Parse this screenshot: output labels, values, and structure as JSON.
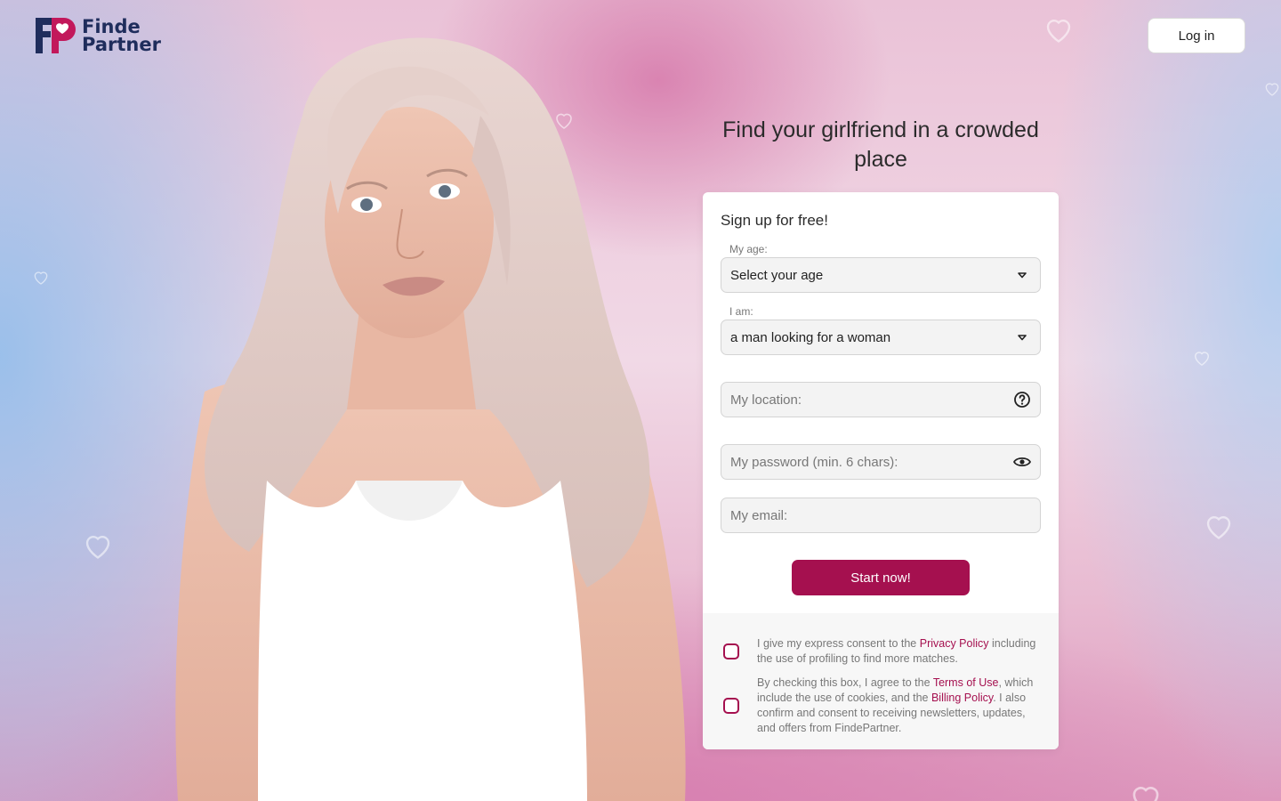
{
  "brand": {
    "logo_mark": "FP",
    "line1": "Finde",
    "line2": "Partner"
  },
  "header": {
    "login_label": "Log in"
  },
  "headline": "Find your girlfriend in a crowded place",
  "form": {
    "title": "Sign up for free!",
    "age": {
      "label": "My age:",
      "value": "Select your age",
      "icon": "chevron-down-icon"
    },
    "gender": {
      "label": "I am:",
      "value": "a man looking for a woman",
      "icon": "chevron-down-icon"
    },
    "location": {
      "placeholder": "My location:",
      "icon": "help-circle-icon"
    },
    "password": {
      "placeholder": "My password (min. 6 chars):",
      "icon": "eye-icon"
    },
    "email": {
      "placeholder": "My email:"
    },
    "submit_label": "Start now!"
  },
  "consent": {
    "privacy": {
      "before": "I give my express consent to the ",
      "link": "Privacy Policy",
      "after": " including the use of profiling to find more matches."
    },
    "terms": {
      "before": "By checking this box, I agree to the ",
      "link1": "Terms of Use",
      "middle": ", which include the use of cookies, and the ",
      "link2": "Billing Policy",
      "after": ". I also confirm and consent to receiving newsletters, updates, and offers from FindePartner."
    }
  },
  "colors": {
    "brand_accent": "#a5104f",
    "logo_navy": "#1f2d5c",
    "logo_pink": "#c2185b"
  }
}
